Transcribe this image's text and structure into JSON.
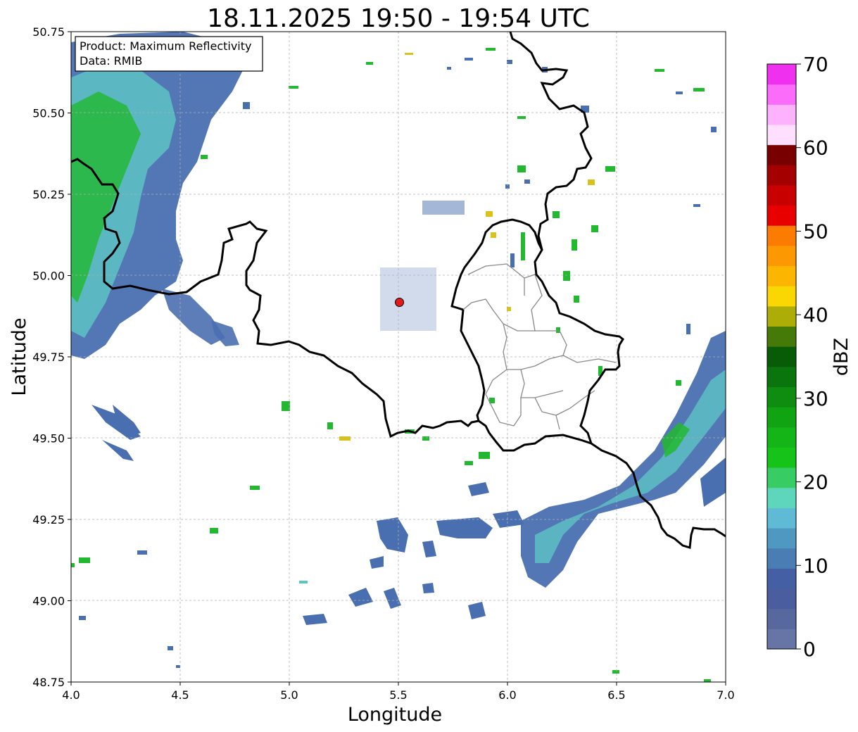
{
  "title": "18.11.2025 19:50 - 19:54 UTC",
  "info_box": {
    "product_line": "Product: Maximum Reflectivity",
    "data_line": "Data: RMIB"
  },
  "chart_data": {
    "type": "heatmap",
    "title": "18.11.2025 19:50 - 19:54 UTC",
    "xlabel": "Longitude",
    "ylabel": "Latitude",
    "xlim": [
      4.0,
      7.0
    ],
    "ylim": [
      48.75,
      50.75
    ],
    "x_ticks": [
      "4.0",
      "4.5",
      "5.0",
      "5.5",
      "6.0",
      "6.5",
      "7.0"
    ],
    "y_ticks": [
      "48.75",
      "49.00",
      "49.25",
      "49.50",
      "49.75",
      "50.00",
      "50.25",
      "50.50",
      "50.75"
    ],
    "grid": true,
    "radar_site": {
      "lon": 5.505,
      "lat": 49.915
    },
    "colorbar": {
      "label": "dBZ",
      "min": 0,
      "max": 70,
      "ticks": [
        "0",
        "10",
        "20",
        "30",
        "40",
        "50",
        "60",
        "70"
      ],
      "colors": [
        "#6675a6",
        "#56689e",
        "#4a5d9e",
        "#455fa4",
        "#4a7db3",
        "#4f98c1",
        "#5ebad5",
        "#5dd6bc",
        "#38cc65",
        "#16c419",
        "#14b517",
        "#10a312",
        "#0f8d10",
        "#0a750c",
        "#085c08",
        "#467a08",
        "#acad06",
        "#fad602",
        "#fcb602",
        "#fc9902",
        "#fc7c02",
        "#e80000",
        "#c80000",
        "#a50000",
        "#790000",
        "#fee0fe",
        "#fdb2fd",
        "#fb6cfb",
        "#ef31ef"
      ]
    }
  }
}
